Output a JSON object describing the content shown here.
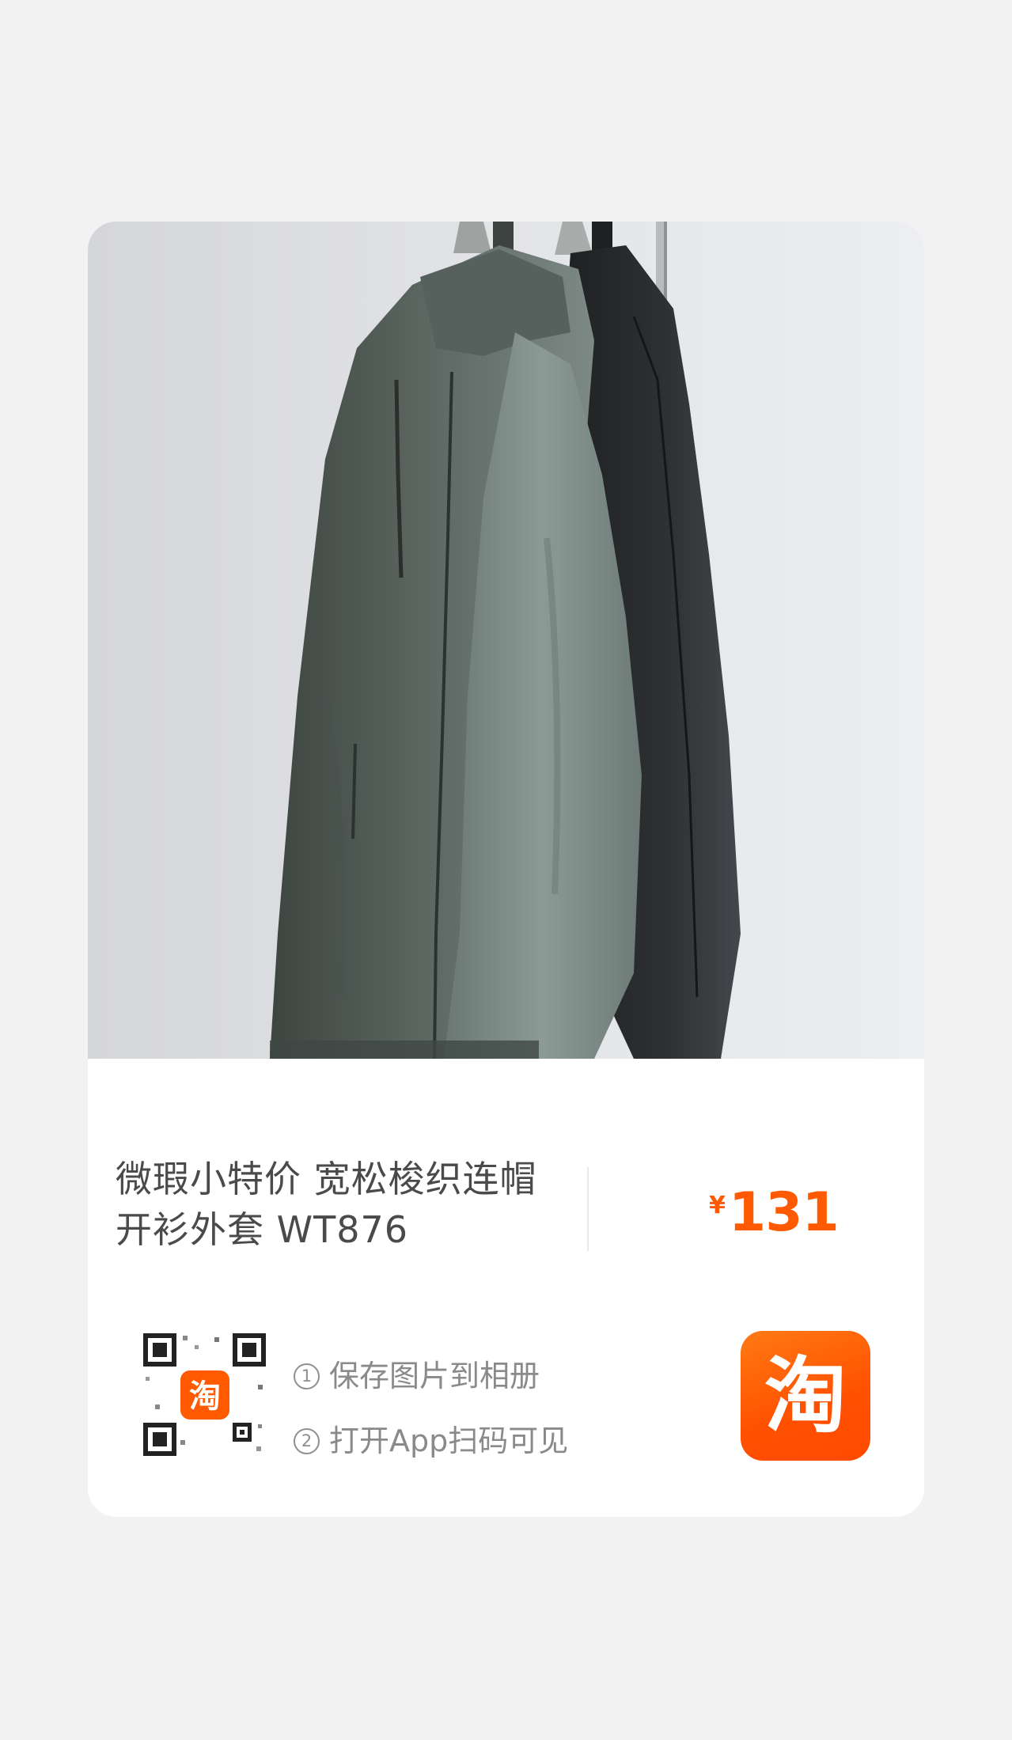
{
  "product": {
    "title_line1": "微瑕小特价 宽松梭织连帽",
    "title_line2": "开衫外套 WT876",
    "currency_symbol": "¥",
    "price": "131"
  },
  "share": {
    "step1_num": "①",
    "step1_label": "保存图片到相册",
    "step2_num": "②",
    "step2_label": "打开App扫码可见",
    "qr_badge_char": "淘"
  },
  "brand": {
    "logo_char": "淘",
    "accent_color": "#ff5000"
  },
  "icons": {
    "photo": "product-photo",
    "qr": "qr-code-icon",
    "logo": "taobao-logo-icon"
  }
}
